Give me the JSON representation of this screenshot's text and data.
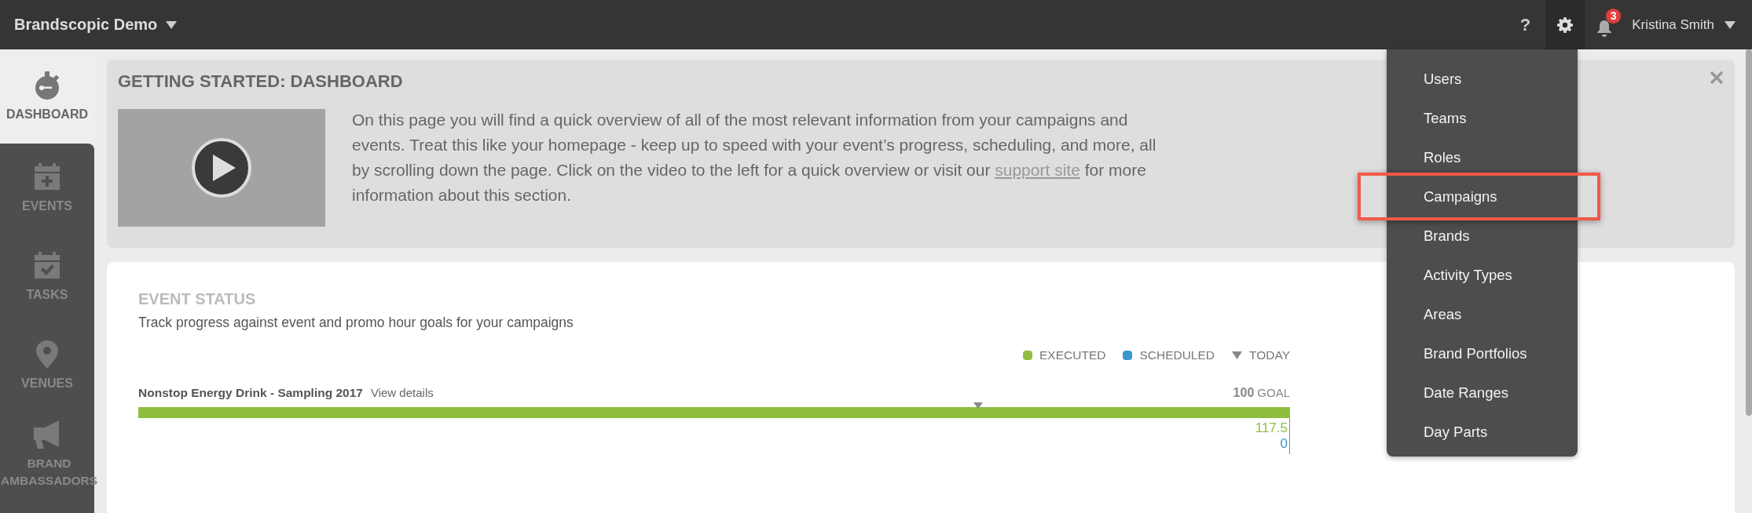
{
  "topbar": {
    "brand": "Brandscopic Demo",
    "help": "?",
    "notifications": "3",
    "user": "Kristina Smith"
  },
  "sidebar": {
    "items": [
      {
        "label": "DASHBOARD",
        "selected": true
      },
      {
        "label": "EVENTS",
        "selected": false
      },
      {
        "label": "TASKS",
        "selected": false
      },
      {
        "label": "VENUES",
        "selected": false
      },
      {
        "label": "BRAND AMBASSADORS",
        "selected": false
      }
    ]
  },
  "getting_started": {
    "title": "GETTING STARTED: DASHBOARD",
    "description": {
      "before": "On this page you will find a quick overview of all of the most relevant information from your campaigns and events. Treat this like your homepage - keep up to speed with your event’s progress, scheduling, and more, all by scrolling down the page. Click on the video to the left for a quick overview or visit our ",
      "link": "support site",
      "after": " for more information about this section."
    }
  },
  "event_status": {
    "title": "EVENT STATUS",
    "subtitle": "Track progress against event and promo hour goals for your campaigns",
    "legend": [
      {
        "kind": "dot",
        "color": "#8fbe3f",
        "label": "EXECUTED"
      },
      {
        "kind": "dot",
        "color": "#3a96cf",
        "label": "SCHEDULED"
      },
      {
        "kind": "marker",
        "label": "TODAY"
      }
    ],
    "campaigns": [
      {
        "name": "Nonstop Energy Drink - Sampling 2017",
        "link": "View details",
        "goal_value": "100",
        "goal_label": "GOAL",
        "executed": {
          "value": "117.5",
          "level": 1
        },
        "scheduled": {
          "value": "0"
        },
        "today": {
          "level": 0.729
        }
      }
    ]
  },
  "settings_menu": {
    "open": true,
    "items": [
      {
        "label": "Users",
        "highlighted": false
      },
      {
        "label": "Teams",
        "highlighted": false
      },
      {
        "label": "Roles",
        "highlighted": false
      },
      {
        "label": "Campaigns",
        "highlighted": true
      },
      {
        "label": "Brands",
        "highlighted": false
      },
      {
        "label": "Activity Types",
        "highlighted": false
      },
      {
        "label": "Areas",
        "highlighted": false
      },
      {
        "label": "Brand Portfolios",
        "highlighted": false
      },
      {
        "label": "Date Ranges",
        "highlighted": false
      },
      {
        "label": "Day Parts",
        "highlighted": false
      }
    ]
  }
}
